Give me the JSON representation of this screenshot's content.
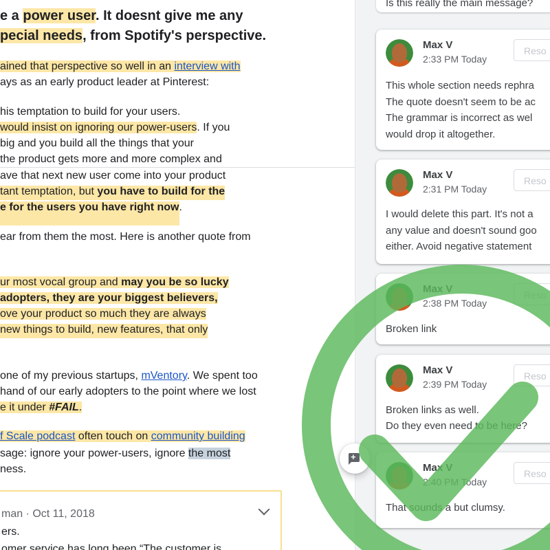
{
  "document": {
    "heading_line1": {
      "pre": "e a ",
      "hl": "power user",
      "post": ". It doesnt give me any"
    },
    "heading_line2": {
      "hl": "pecial needs",
      "post": ", from Spotify's perspective."
    },
    "p1_line1": {
      "text": "ained that perspective so well in an ",
      "link": "interview with"
    },
    "p1_line2": "ays as an early product leader at Pinterest:",
    "q_line1": "his temptation to build for your users.",
    "q_line2": {
      "hl": "would insist on ignoring our power-users",
      "post": ". If you"
    },
    "q_line3": " big and you build all the things that your",
    "q_line4": " the product gets more and more complex and",
    "q_line5": "ave that next new user come into your product",
    "q_line6": {
      "hl": "tant temptation, but ",
      "bold": "you have to build for the"
    },
    "q_line7": {
      "bold": "e for the users you have right now",
      "post": "."
    },
    "p2_line1": "ear from them the most. Here is another quote from",
    "q2_line1": {
      "hl": "ur most vocal group and ",
      "bold": "may you be so lucky"
    },
    "q2_line2": {
      "bold": " adopters, they are your biggest believers,"
    },
    "q2_line3": "ove your product so much they are always",
    "q2_line4": "new things to build, new features, that only",
    "p3_line1": {
      "text": "one of my previous startups, ",
      "link": "mVentory",
      "post": ". We spent too"
    },
    "p3_line2": "hand of our early adopters to the point where we lost",
    "p3_line3": {
      "pre": "e it under ",
      "em": "#FAIL",
      "post": "."
    },
    "p4_line1": {
      "link1": "f Scale podcast",
      "mid": " often touch on ",
      "link2": "community building"
    },
    "p4_line2": {
      "text": "sage: ignore your power-users, ignore ",
      "sel": "the most"
    },
    "p4_line3": "ness.",
    "embed": {
      "meta": "man · Oct 11, 2018",
      "line1": "ers.",
      "line2": "omer service has long been “The customer is"
    }
  },
  "comments": {
    "top_partial": "Is this really the main message?",
    "resolve_label": "Reso",
    "items": [
      {
        "author": "Max V",
        "time": "2:33 PM Today",
        "lines": [
          "This whole section needs rephra",
          "The quote doesn't seem to be ac",
          "The grammar is incorrect as wel",
          "would drop it altogether."
        ]
      },
      {
        "author": "Max V",
        "time": "2:31 PM Today",
        "lines": [
          "I would delete this part. It's not a",
          "any value and doesn't sound goo",
          "either. Avoid negative statement"
        ]
      },
      {
        "author": "Max V",
        "time": "2:38 PM Today",
        "lines": [
          "Broken link"
        ]
      },
      {
        "author": "Max V",
        "time": "2:39 PM Today",
        "lines": [
          "Broken links as well.",
          "Do they even need to be here?"
        ]
      },
      {
        "author": "Max V",
        "time": "2:40 PM Today",
        "lines": [
          "That sounds a but clumsy."
        ]
      }
    ]
  },
  "icons": {
    "add_comment": "add-comment-icon",
    "chevron": "chevron-down-icon",
    "checkmark": "checkmark-overlay-icon"
  },
  "colors": {
    "highlight": "#fde7a6",
    "link": "#1a55c7",
    "check_green": "#5cb85c"
  }
}
